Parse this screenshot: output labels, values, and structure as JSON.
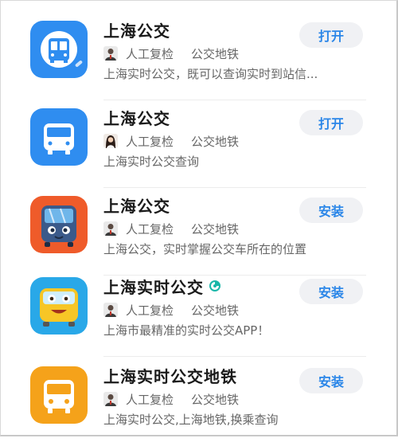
{
  "apps": [
    {
      "title": "上海公交",
      "reviewer": "人工复检",
      "category": "公交地铁",
      "description": "上海实时公交，既可以查询实时到站信...",
      "action": "打开",
      "icon": "bus-front-circle-icon",
      "avatar": "man-avatar-icon",
      "verified": false
    },
    {
      "title": "上海公交",
      "reviewer": "人工复检",
      "category": "公交地铁",
      "description": "上海实时公交查询",
      "action": "打开",
      "icon": "bus-front-icon",
      "avatar": "woman-avatar-icon",
      "verified": false
    },
    {
      "title": "上海公交",
      "reviewer": "人工复检",
      "category": "公交地铁",
      "description": "上海公交，实时掌握公交车所在的位置",
      "action": "安装",
      "icon": "cartoon-bus-icon",
      "avatar": "man-avatar-icon",
      "verified": false
    },
    {
      "title": "上海实时公交",
      "reviewer": "人工复检",
      "category": "公交地铁",
      "description": "上海市最精准的实时公交APP！",
      "action": "安装",
      "icon": "yellow-cartoon-bus-icon",
      "avatar": "man-avatar-icon",
      "verified": true
    },
    {
      "title": "上海实时公交地铁",
      "reviewer": "人工复检",
      "category": "公交地铁",
      "description": "上海实时公交,上海地铁,换乘查询",
      "action": "安装",
      "icon": "bus-front-yellow-icon",
      "avatar": "man-avatar-icon",
      "verified": false
    }
  ],
  "colors": {
    "button_bg": "#f0f1f4",
    "button_text": "#2a86e8",
    "title": "#1a1a1a",
    "secondary_text": "#666666"
  }
}
